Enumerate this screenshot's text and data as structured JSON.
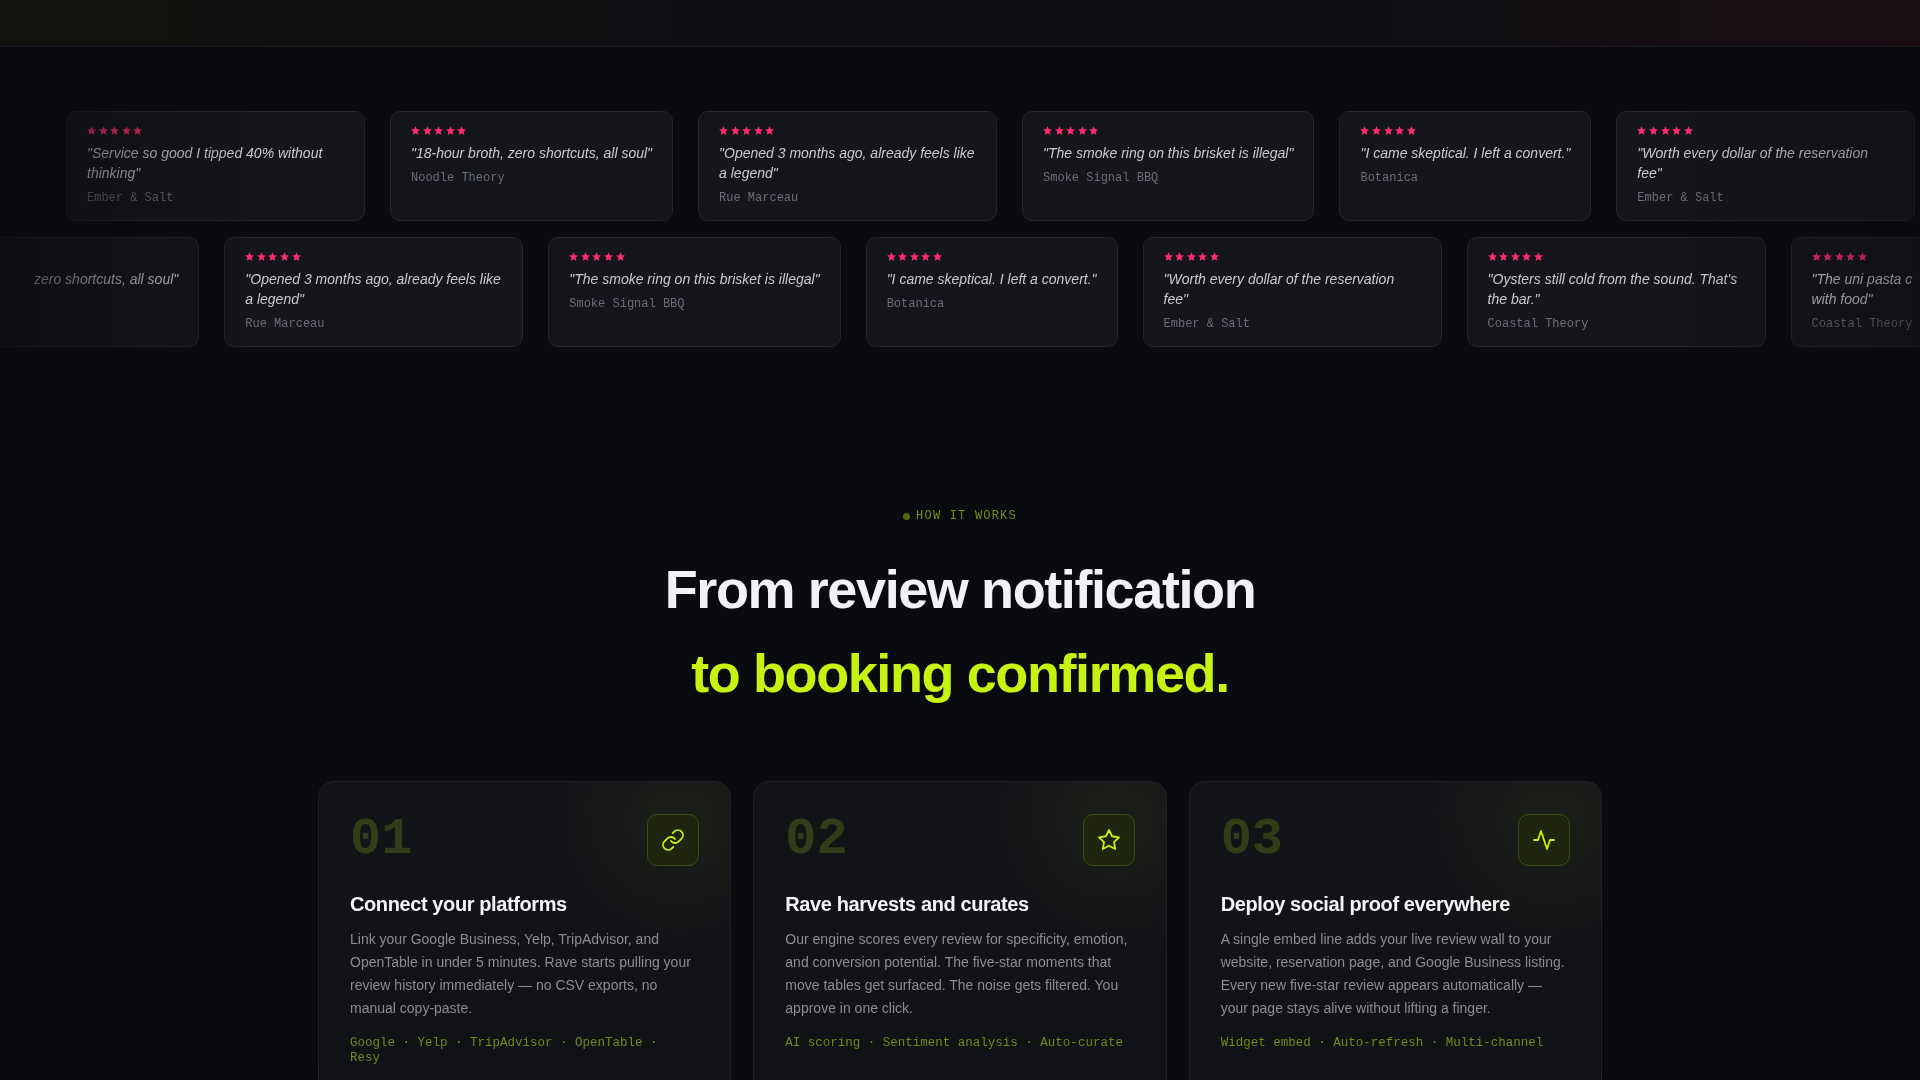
{
  "testimonial_rows": [
    [
      {
        "kind": "full",
        "stars": 5,
        "quote": "\"Service so good I tipped 40% without thinking\"",
        "author": "Ember & Salt"
      },
      {
        "kind": "full",
        "stars": 5,
        "quote": "\"18-hour broth, zero shortcuts, all soul\"",
        "author": "Noodle Theory"
      },
      {
        "kind": "full",
        "stars": 5,
        "quote": "\"Opened 3 months ago, already feels like a legend\"",
        "author": "Rue Marceau"
      },
      {
        "kind": "full",
        "stars": 5,
        "quote": "\"The smoke ring on this brisket is illegal\"",
        "author": "Smoke Signal BBQ"
      },
      {
        "kind": "full",
        "stars": 5,
        "quote": "\"I came skeptical. I left a convert.\"",
        "author": "Botanica"
      },
      {
        "kind": "full",
        "stars": 5,
        "quote": "\"Worth every dollar of the reservation fee\"",
        "author": "Ember & Salt"
      }
    ],
    [
      {
        "kind": "cut_left",
        "quote": "zero shortcuts, all soul\""
      },
      {
        "kind": "full",
        "stars": 5,
        "quote": "\"Opened 3 months ago, already feels like a legend\"",
        "author": "Rue Marceau"
      },
      {
        "kind": "full",
        "stars": 5,
        "quote": "\"The smoke ring on this brisket is illegal\"",
        "author": "Smoke Signal BBQ"
      },
      {
        "kind": "full",
        "stars": 5,
        "quote": "\"I came skeptical. I left a convert.\"",
        "author": "Botanica"
      },
      {
        "kind": "full",
        "stars": 5,
        "quote": "\"Worth every dollar of the reservation fee\"",
        "author": "Ember & Salt"
      },
      {
        "kind": "full",
        "stars": 5,
        "quote": "\"Oysters still cold from the sound. That's the bar.\"",
        "author": "Coastal Theory"
      },
      {
        "kind": "cut_right",
        "stars": 5,
        "quote_lines": [
          "\"The uni pasta c",
          "with food\""
        ],
        "author": "Coastal Theory"
      }
    ]
  ],
  "how_it_works": {
    "eyebrow": "HOW IT WORKS",
    "heading": "From review notification",
    "heading_accent": "to booking confirmed.",
    "steps": [
      {
        "number": "01",
        "title": "Connect your platforms",
        "description": "Link your Google Business, Yelp, TripAdvisor, and OpenTable in under 5 minutes. Rave starts pulling your review history immediately — no CSV exports, no manual copy-paste.",
        "tags": "Google · Yelp · TripAdvisor · OpenTable · Resy"
      },
      {
        "number": "02",
        "title": "Rave harvests and curates",
        "description": "Our engine scores every review for specificity, emotion, and conversion potential. The five-star moments that move tables get surfaced. The noise gets filtered. You approve in one click.",
        "tags": "AI scoring · Sentiment analysis · Auto-curate"
      },
      {
        "number": "03",
        "title": "Deploy social proof everywhere",
        "description": "A single embed line adds your live review wall to your website, reservation page, and Google Business listing. Every new five-star review appears automatically — your page stays alive without lifting a finger.",
        "tags": "Widget embed · Auto-refresh · Multi-channel"
      }
    ]
  }
}
